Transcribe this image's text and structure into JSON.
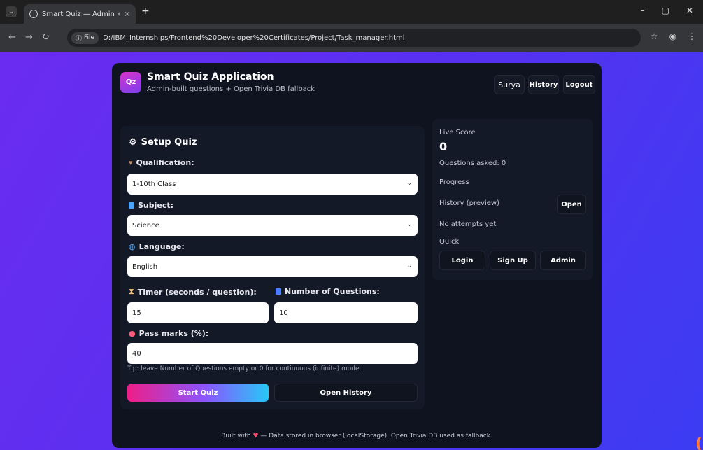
{
  "browser": {
    "tab_title": "Smart Quiz — Admin + OpenTr",
    "tab_close": "×",
    "new_tab": "+",
    "file_chip": "File",
    "url": "D:/IBM_Internships/Frontend%20Developer%20Certificates/Project/Task_manager.html"
  },
  "app": {
    "logo": "Qz",
    "title": "Smart Quiz Application",
    "subtitle": "Admin-built questions + Open Trivia DB fallback",
    "user": "Surya",
    "history_btn": "History",
    "logout_btn": "Logout"
  },
  "setup": {
    "title": "Setup Quiz",
    "qualification_label": "Qualification:",
    "qualification_value": "1-10th Class",
    "subject_label": "Subject:",
    "subject_value": "Science",
    "language_label": "Language:",
    "language_value": "English",
    "timer_label": "Timer (seconds / question):",
    "timer_value": "15",
    "numq_label": "Number of Questions:",
    "numq_value": "10",
    "pass_label": "Pass marks (%):",
    "pass_value": "40",
    "tip": "Tip: leave Number of Questions empty or 0 for continuous (infinite) mode.",
    "start_btn": "Start Quiz",
    "open_history_btn": "Open History"
  },
  "sidebar": {
    "live_score_label": "Live Score",
    "score": "0",
    "questions_asked": "Questions asked: 0",
    "progress_label": "Progress",
    "history_preview_label": "History (preview)",
    "open_btn": "Open",
    "no_attempts": "No attempts yet",
    "quick_label": "Quick",
    "login_btn": "Login",
    "signup_btn": "Sign Up",
    "admin_btn": "Admin"
  },
  "footer": {
    "built_with": "Built with",
    "heart": "♥",
    "rest": "— Data stored in browser (localStorage). Open Trivia DB used as fallback."
  },
  "colors": {
    "accent_pink": "#ee1e87",
    "accent_cyan": "#27c8f6",
    "card_bg": "#0f1320",
    "page_gradient_start": "#6a2cf0",
    "page_gradient_end": "#3b3cf3"
  }
}
